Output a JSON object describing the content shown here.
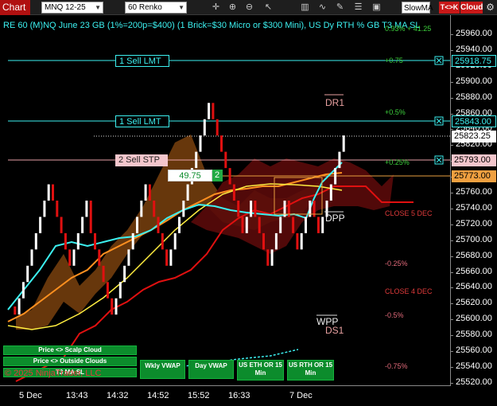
{
  "toolbar": {
    "chart_tab": "Chart",
    "instrument": "MNQ 12-25",
    "period": "60 Renko",
    "slowma": "SlowMA",
    "tk": "T<>K",
    "cloud": "Cloud",
    "icons": [
      "crosshair-icon",
      "zoom-in-icon",
      "zoom-out-icon",
      "cursor-icon",
      "strategy-icon",
      "indicator-icon",
      "draw-icon",
      "properties-icon",
      "snapshot-icon"
    ]
  },
  "chart_title": "RE 60 (M)NQ June 23 GB (1%=200p=$400) (1 Brick=$30 Micro or $300 Mini), US Dy RTH % GB T3 MA SL",
  "price_axis": {
    "ticks": [
      "25960.00",
      "25940.00",
      "25920.00",
      "25900.00",
      "25880.00",
      "25860.00",
      "25840.00",
      "25820.00",
      "25800.00",
      "25780.00",
      "25760.00",
      "25740.00",
      "25720.00",
      "25700.00",
      "25680.00",
      "25660.00",
      "25640.00",
      "25620.00",
      "25600.00",
      "25580.00",
      "25560.00",
      "25540.00",
      "25520.00"
    ],
    "labels": {
      "sell_lmt_1": "25918.75",
      "sell_lmt_2": "25843.00",
      "last": "25823.25",
      "sell_stp": "25793.00",
      "level_773": "25773.00"
    }
  },
  "time_axis": [
    "5 Dec",
    "13:43",
    "14:32",
    "14:52",
    "15:52",
    "16:33",
    "7 Dec"
  ],
  "orders": {
    "sell_lmt_top": "1 Sell LMT",
    "sell_lmt_mid": "1 Sell LMT",
    "sell_stp": "2 Sell STP",
    "pnl": "49.75",
    "qty": "2"
  },
  "levels": {
    "pct_075_top": "+0.75",
    "pct_05": "+0.5%",
    "pct_025": "+0.25%",
    "pct_m025": "-0.25%",
    "pct_m05": "-0.5%",
    "pct_m075": "-0.75%",
    "pct_top": "0.93% + 41.25",
    "dr1": "DR1",
    "dpp": "DPP",
    "wpp": "WPP",
    "ds1": "DS1",
    "close5": "CLOSE 5 DEC",
    "close4": "CLOSE 4 DEC"
  },
  "buttons": {
    "scalp_cloud": "Price <> Scalp Cloud",
    "outside_clouds": "Price <> Outside Clouds",
    "t3_ma_sl": "T3 MA SL",
    "wkly_vwap": "Wkly VWAP",
    "day_vwap": "Day VWAP",
    "us_eth": "US ETH OR 15 Min",
    "us_rth": "US RTH OR 15 Min"
  },
  "copyright": "© 2025 NinjaTrader, LLC",
  "colors": {
    "cyan": "#3cf0f0",
    "up_brick": "#ffffff",
    "down_brick": "#e01010",
    "cloud_orange": "#8a4a10",
    "cloud_red": "#6a0c0c",
    "accent_red": "#c81818",
    "green_button": "#0c8c2c"
  },
  "chart_data": {
    "type": "line",
    "price_min": 25520,
    "price_max": 25960,
    "bricks": [
      25610,
      25600,
      25620,
      25640,
      25660,
      25680,
      25700,
      25720,
      25740,
      25760,
      25740,
      25720,
      25700,
      25680,
      25660,
      25680,
      25700,
      25720,
      25740,
      25700,
      25680,
      25660,
      25640,
      25620,
      25600,
      25620,
      25640,
      25660,
      25680,
      25700,
      25720,
      25740,
      25760,
      25740,
      25720,
      25700,
      25680,
      25660,
      25680,
      25700,
      25720,
      25740,
      25760,
      25780,
      25800,
      25820,
      25840,
      25860,
      25840,
      25820,
      25800,
      25780,
      25760,
      25740,
      25720,
      25700,
      25720,
      25740,
      25720,
      25700,
      25680,
      25660,
      25680,
      25700,
      25720,
      25740,
      25720,
      25700,
      25680,
      25700,
      25720,
      25740,
      25720,
      25700,
      25720,
      25740,
      25760,
      25780,
      25800,
      25820
    ]
  }
}
